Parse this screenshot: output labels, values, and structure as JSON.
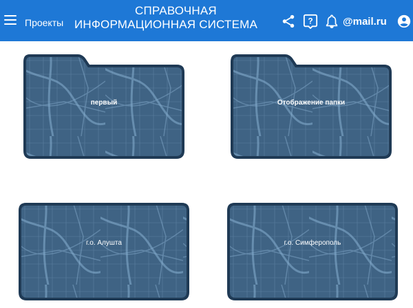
{
  "header": {
    "projects_label": "Проекты",
    "title_line1": "СПРАВОЧНАЯ",
    "title_line2": "ИНФОРМАЦИОННАЯ СИСТЕМА",
    "email": "@mail.ru",
    "icons": [
      "menu-icon",
      "share-icon",
      "help-icon",
      "bell-icon",
      "account-icon"
    ]
  },
  "folders": [
    {
      "label": "первый"
    },
    {
      "label": "Отображение папки"
    },
    {
      "label": "г.о. Алушта"
    },
    {
      "label": "г.о. Симферополь"
    }
  ],
  "colors": {
    "header_bg": "#1e78d6",
    "folder_fill": "#3f6384",
    "folder_border": "#1f3a55",
    "map_lines": "#7ea6c8"
  }
}
